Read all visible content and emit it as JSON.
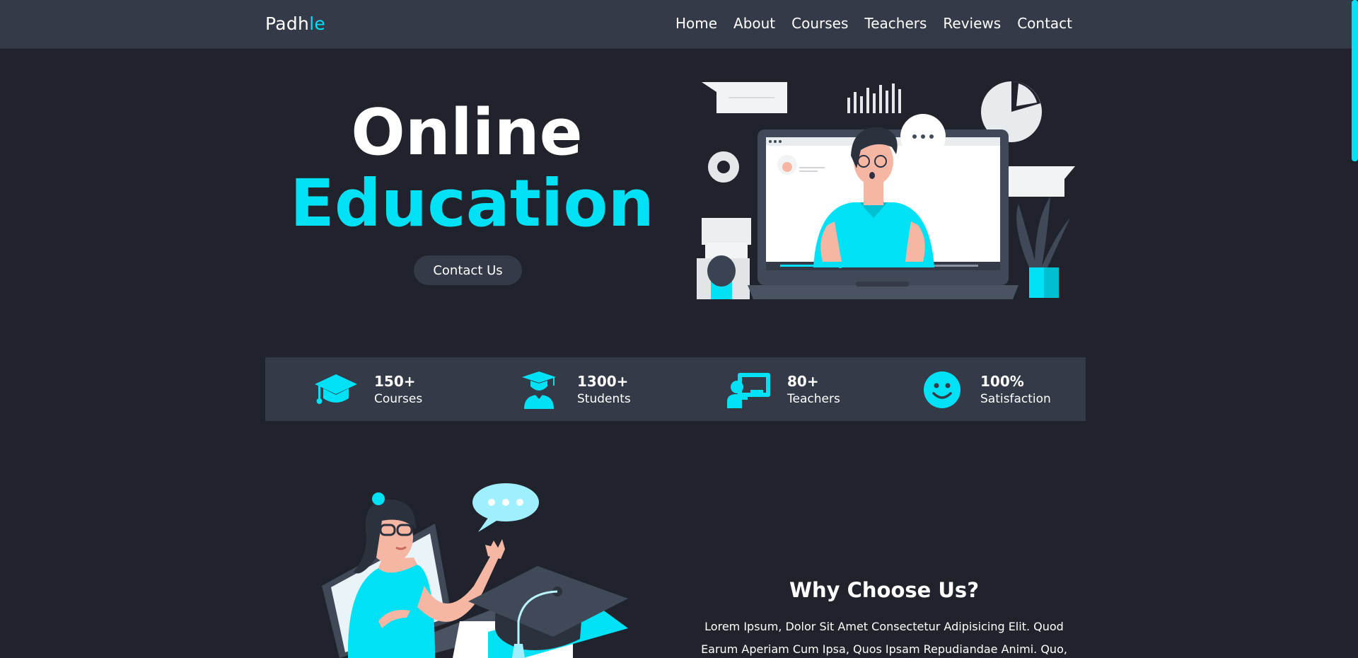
{
  "brand": {
    "name_plain": "Padh",
    "name_accent": "le"
  },
  "nav": {
    "items": [
      "Home",
      "About",
      "Courses",
      "Teachers",
      "Reviews",
      "Contact"
    ]
  },
  "hero": {
    "line1": "Online",
    "line2": "Education",
    "cta": "Contact Us"
  },
  "stats": [
    {
      "value": "150+",
      "label": "Courses",
      "icon": "graduation-cap-icon"
    },
    {
      "value": "1300+",
      "label": "Students",
      "icon": "student-icon"
    },
    {
      "value": "80+",
      "label": "Teachers",
      "icon": "teacher-icon"
    },
    {
      "value": "100%",
      "label": "Satisfaction",
      "icon": "smile-icon"
    }
  ],
  "why": {
    "title": "Why Choose Us?",
    "text": "Lorem Ipsum, Dolor Sit Amet Consectetur Adipisicing Elit. Quod Earum Aperiam Cum Ipsa, Quos Ipsam Repudiandae Animi. Quo, Non Fugit!"
  },
  "colors": {
    "accent": "#00e1f5",
    "background": "#20232b",
    "surface": "#343a47"
  }
}
